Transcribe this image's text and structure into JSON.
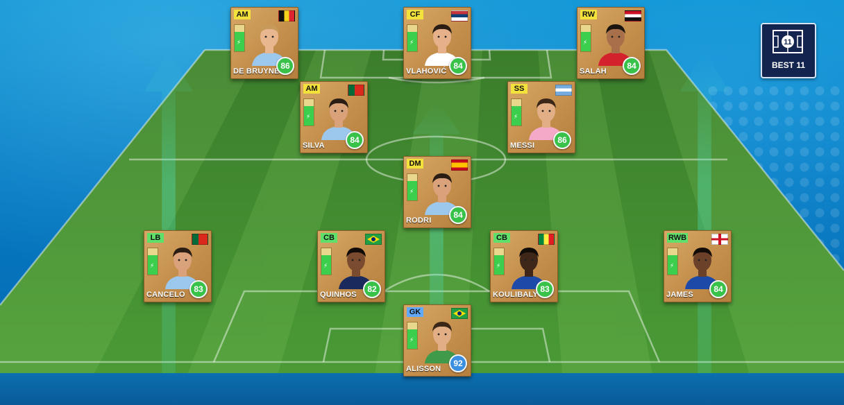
{
  "badge": {
    "label": "BEST 11"
  },
  "colors": {
    "card_gold": "#c48f4c",
    "rating_green": "#39c24a",
    "rating_gk_blue": "#3a8fe0",
    "pitch_green": "#3f8a30"
  },
  "players": [
    {
      "id": "debruyne",
      "position": "AM",
      "name": "DE BRUYNE",
      "rating": "86",
      "flag": "belgium",
      "energy": 0.75,
      "kit": "#9cc8ee",
      "skin": "#e8b68f",
      "hair": "#c79a5a"
    },
    {
      "id": "vlahovic",
      "position": "CF",
      "name": "VLAHOVIĆ",
      "rating": "84",
      "flag": "serbia",
      "energy": 0.75,
      "kit": "#ffffff",
      "skin": "#e6b08a",
      "hair": "#2a1e14"
    },
    {
      "id": "salah",
      "position": "RW",
      "name": "SALAH",
      "rating": "84",
      "flag": "egypt",
      "energy": 0.75,
      "kit": "#d3222b",
      "skin": "#a8704a",
      "hair": "#1c140e"
    },
    {
      "id": "silva",
      "position": "AM",
      "name": "SILVA",
      "rating": "84",
      "flag": "portugal",
      "energy": 0.75,
      "kit": "#9cc8ee",
      "skin": "#d9a27a",
      "hair": "#2a1e14"
    },
    {
      "id": "messi",
      "position": "SS",
      "name": "MESSI",
      "rating": "86",
      "flag": "argentina",
      "energy": 0.75,
      "kit": "#f5a9c8",
      "skin": "#e2ae86",
      "hair": "#3b2718"
    },
    {
      "id": "rodri",
      "position": "DM",
      "name": "RODRI",
      "rating": "84",
      "flag": "spain",
      "energy": 0.75,
      "kit": "#9cc8ee",
      "skin": "#d9a27a",
      "hair": "#2a1e14"
    },
    {
      "id": "cancelo",
      "position": "LB",
      "name": "CANCELO",
      "rating": "83",
      "flag": "portugal",
      "energy": 0.75,
      "kit": "#9cc8ee",
      "skin": "#d9a27a",
      "hair": "#2a1e14"
    },
    {
      "id": "quinhos",
      "position": "CB",
      "name": "QUINHOS",
      "rating": "82",
      "flag": "brazil",
      "energy": 0.75,
      "kit": "#1b2a5c",
      "skin": "#7a4b2e",
      "hair": "#120c08"
    },
    {
      "id": "koulibaly",
      "position": "CB",
      "name": "KOULIBALY",
      "rating": "83",
      "flag": "senegal",
      "energy": 0.75,
      "kit": "#1d4aa8",
      "skin": "#3e2718",
      "hair": "#120c08"
    },
    {
      "id": "james",
      "position": "RWB",
      "name": "JAMES",
      "rating": "84",
      "flag": "england",
      "energy": 0.75,
      "kit": "#1d4aa8",
      "skin": "#6b4129",
      "hair": "#120c08"
    },
    {
      "id": "alisson",
      "position": "GK",
      "name": "ALISSON",
      "rating": "92",
      "flag": "brazil",
      "energy": 0.75,
      "kit": "#3f9a4a",
      "skin": "#e2ae86",
      "hair": "#3b2718"
    }
  ]
}
